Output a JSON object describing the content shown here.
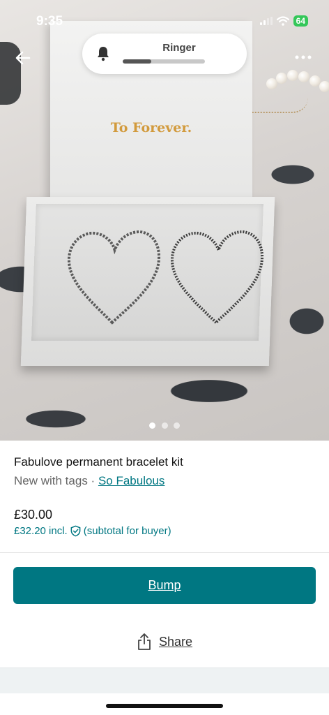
{
  "status_bar": {
    "time": "9:35",
    "battery": "64",
    "icons": [
      "signal-icon",
      "wifi-icon",
      "battery-charging-icon"
    ]
  },
  "ringer": {
    "label": "Ringer",
    "level": 0.35
  },
  "photo": {
    "printed_text": "To Forever.",
    "page_count": 3,
    "current_page": 1
  },
  "listing": {
    "title": "Fabulove permanent bracelet kit",
    "condition": "New with tags",
    "separator": " · ",
    "brand": "So Fabulous",
    "price": "£30.00",
    "price_incl": "£32.20 incl.",
    "subtotal_note": "(subtotal for buyer)"
  },
  "actions": {
    "bump_label": "Bump",
    "share_label": "Share"
  },
  "colors": {
    "accent": "#007782",
    "battery": "#34c759"
  }
}
